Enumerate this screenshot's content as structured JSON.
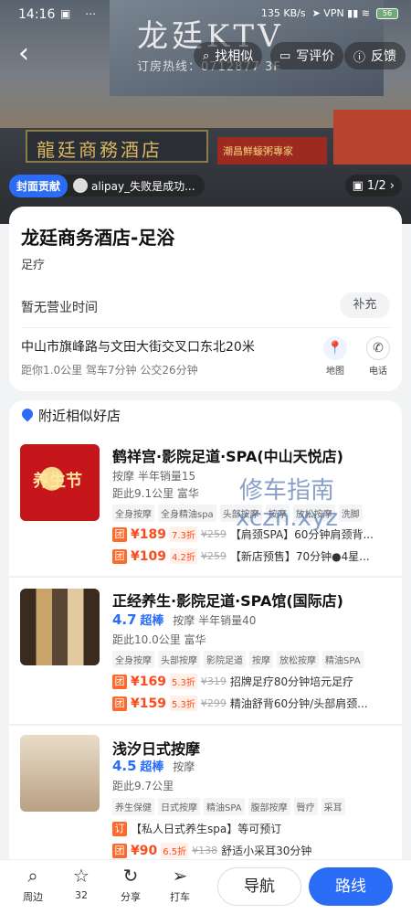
{
  "status_bar": {
    "time": "14:16",
    "left_icons": "▣ ⋯",
    "net_speed": "135 KB/s",
    "right_icons": "➤ VPN ▮▮ ≋",
    "battery": "56"
  },
  "hero": {
    "sign_text": "龙廷KTV",
    "sign_phone": "订房热线：0712877 3F",
    "lower_sign": "龍廷商務酒店",
    "side_sign": "潮昌鮮蠔粥專家"
  },
  "header": {
    "back_label": "‹",
    "find_similar": "找相似",
    "write_review": "写评价",
    "feedback": "反馈"
  },
  "cover": {
    "badge": "封面贡献",
    "user": "alipay_失败是成功...",
    "photo_count": "1/2"
  },
  "shop": {
    "name": "龙廷商务酒店-足浴",
    "category": "足疗",
    "hours": "暂无营业时间",
    "supplement": "补充",
    "address": "中山市旗峰路与文田大街交叉口东北20米",
    "distance": "距你1.0公里  驾车7分钟  公交26分钟",
    "map_label": "地图",
    "phone_label": "电话"
  },
  "nearby": {
    "title": "附近相似好店",
    "items": [
      {
        "title": "鹤祥宫·影院足道·SPA(中山天悦店)",
        "line1": "按摩  半年销量15",
        "line2": "距此9.1公里  富华",
        "tags": [
          "全身按摩",
          "全身精油spa",
          "头部按摩",
          "按摩",
          "放松按摩",
          "洗脚"
        ],
        "deals": [
          {
            "type": "团",
            "price": "¥189",
            "disc": "7.3折",
            "orig": "¥259",
            "desc": "【肩颈SPA】60分钟肩颈背..."
          },
          {
            "type": "团",
            "price": "¥109",
            "disc": "4.2折",
            "orig": "¥259",
            "desc": "【新店预售】70分钟●4星..."
          }
        ],
        "thumb_text": "养生节"
      },
      {
        "title": "正经养生·影院足道·SPA馆(国际店)",
        "rating": "4.7",
        "rating_tag": "超棒",
        "line1": "按摩  半年销量40",
        "line2": "距此10.0公里  富华",
        "tags": [
          "全身按摩",
          "头部按摩",
          "影院足道",
          "按摩",
          "放松按摩",
          "精油SPA"
        ],
        "deals": [
          {
            "type": "团",
            "price": "¥169",
            "disc": "5.3折",
            "orig": "¥319",
            "desc": "招牌足疗80分钟培元足疗"
          },
          {
            "type": "团",
            "price": "¥159",
            "disc": "5.3折",
            "orig": "¥299",
            "desc": "精油舒背60分钟/头部肩颈..."
          }
        ]
      },
      {
        "title": "浅汐日式按摩",
        "rating": "4.5",
        "rating_tag": "超棒",
        "line1": "按摩",
        "line2": "距此9.7公里",
        "tags": [
          "养生保健",
          "日式按摩",
          "精油SPA",
          "腹部按摩",
          "臀疗",
          "采耳"
        ],
        "booking": {
          "type": "订",
          "desc": "【私人日式养生spa】等可预订"
        },
        "deals": [
          {
            "type": "团",
            "price": "¥90",
            "disc": "6.5折",
            "orig": "¥138",
            "desc": "舒适小采耳30分钟"
          }
        ]
      }
    ]
  },
  "watermark": {
    "line1": "修车指南",
    "line2": "xczn.xyz"
  },
  "bottom_bar": {
    "nearby": "周边",
    "favorites": "32",
    "share": "分享",
    "taxi": "打车",
    "navigate": "导航",
    "route": "路线"
  },
  "colors": {
    "accent": "#2a6cf5",
    "price": "#ff4a1a",
    "deal_badge": "#ff6a2a"
  }
}
